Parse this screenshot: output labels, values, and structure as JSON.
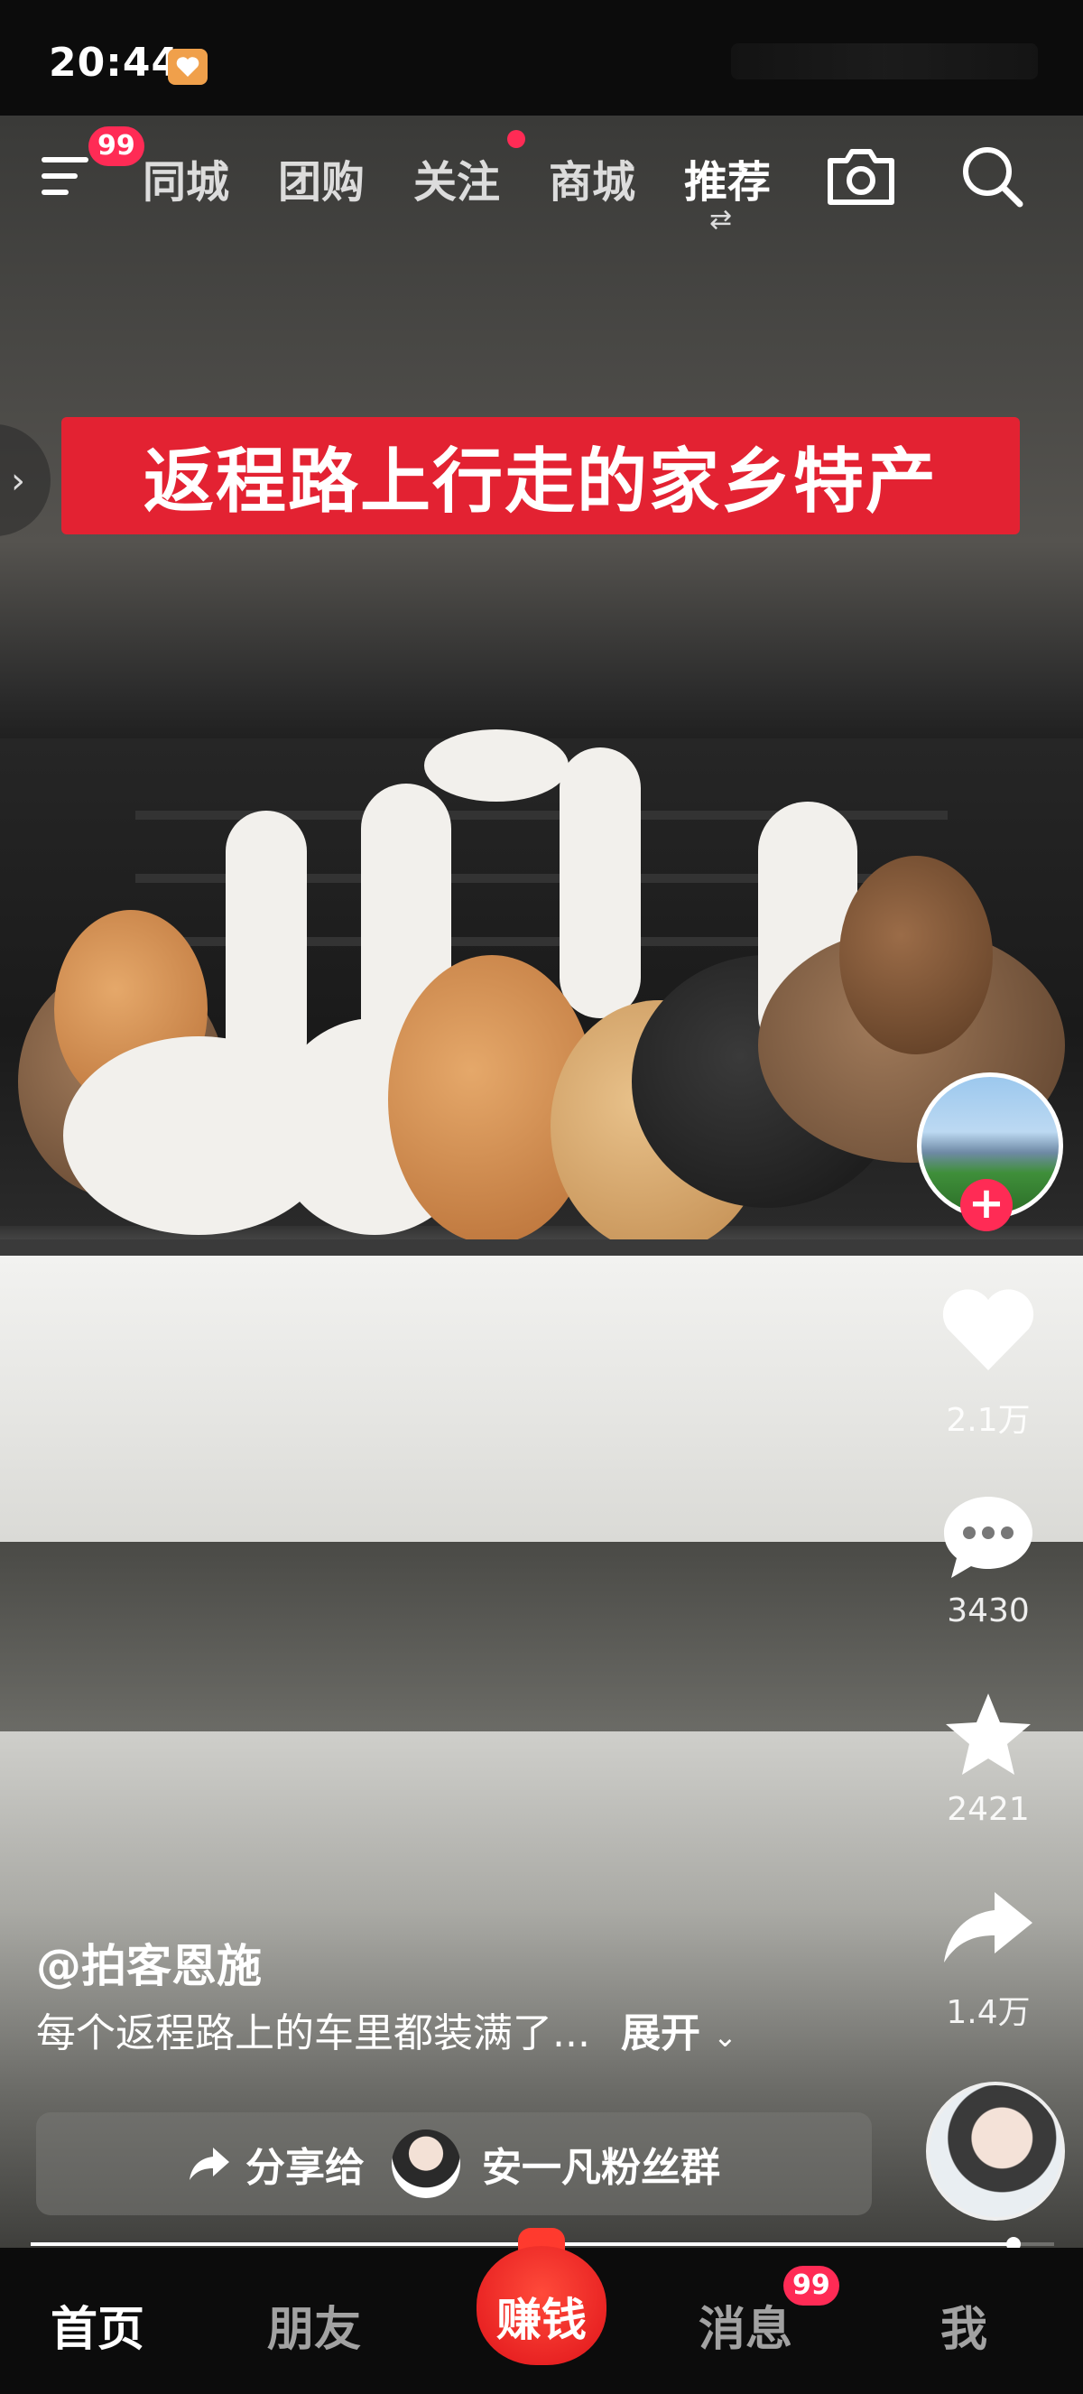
{
  "status_bar": {
    "time": "20:44"
  },
  "top_nav": {
    "menu_badge": "99",
    "tabs": [
      {
        "label": "同城",
        "active": false
      },
      {
        "label": "团购",
        "active": false
      },
      {
        "label": "关注",
        "active": false,
        "has_dot": true
      },
      {
        "label": "商城",
        "active": false
      },
      {
        "label": "推荐",
        "active": true
      }
    ],
    "swap_symbol": "⇄",
    "camera_icon": "camera-icon",
    "search_icon": "search-icon"
  },
  "video": {
    "caption": "返程路上行走的家乡特产"
  },
  "right_rail": {
    "like_count": "2.1万",
    "comment_count": "3430",
    "favorite_count": "2421",
    "share_count": "1.4万",
    "follow_symbol": "+"
  },
  "post": {
    "author": "@拍客恩施",
    "description": "每个返程路上的车里都装满了...",
    "expand_label": "展开",
    "share_prefix": "分享给",
    "share_target": "安一凡粉丝群"
  },
  "progress_fraction": 0.96,
  "bottom_tabs": {
    "home": "首页",
    "friends": "朋友",
    "earn": "赚钱",
    "messages": "消息",
    "messages_badge": "99",
    "me": "我"
  },
  "colors": {
    "accent_red": "#ff2b55",
    "caption_red": "#e32232"
  }
}
